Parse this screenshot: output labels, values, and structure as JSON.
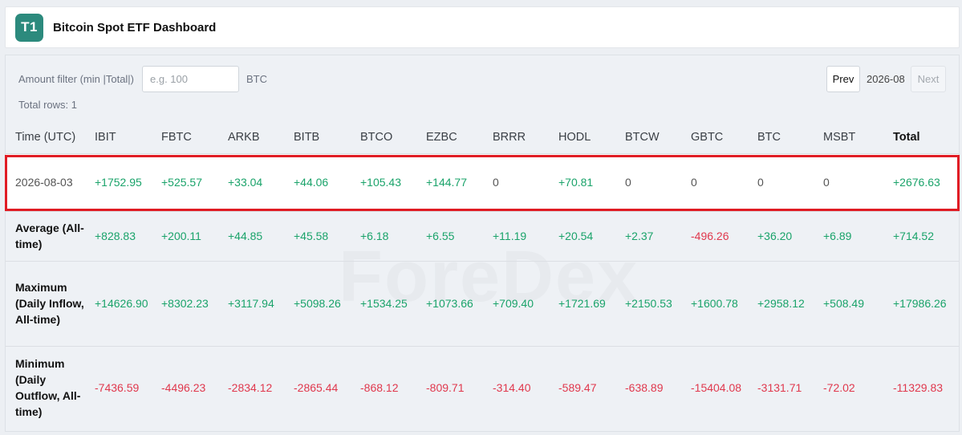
{
  "header": {
    "logo_text": "T1",
    "title": "Bitcoin Spot ETF Dashboard"
  },
  "controls": {
    "filter_label": "Amount filter (min |Total|)",
    "filter_placeholder": "e.g. 100",
    "filter_value": "",
    "unit": "BTC",
    "total_rows": "Total rows: 1",
    "prev_label": "Prev",
    "month": "2026-08",
    "next_label": "Next"
  },
  "watermark": "ForeDex",
  "table": {
    "columns": [
      "Time (UTC)",
      "IBIT",
      "FBTC",
      "ARKB",
      "BITB",
      "BTCO",
      "EZBC",
      "BRRR",
      "HODL",
      "BTCW",
      "GBTC",
      "BTC",
      "MSBT",
      "Total"
    ],
    "rows": [
      {
        "key": "data",
        "label": "2026-08-03",
        "values": [
          "+1752.95",
          "+525.57",
          "+33.04",
          "+44.06",
          "+105.43",
          "+144.77",
          "0",
          "+70.81",
          "0",
          "0",
          "0",
          "0",
          "+2676.63"
        ]
      },
      {
        "key": "avg",
        "label": "Average (All-time)",
        "values": [
          "+828.83",
          "+200.11",
          "+44.85",
          "+45.58",
          "+6.18",
          "+6.55",
          "+11.19",
          "+20.54",
          "+2.37",
          "-496.26",
          "+36.20",
          "+6.89",
          "+714.52"
        ]
      },
      {
        "key": "max",
        "label": "Maximum (Daily Inflow, All-time)",
        "values": [
          "+14626.90",
          "+8302.23",
          "+3117.94",
          "+5098.26",
          "+1534.25",
          "+1073.66",
          "+709.40",
          "+1721.69",
          "+2150.53",
          "+1600.78",
          "+2958.12",
          "+508.49",
          "+17986.26"
        ]
      },
      {
        "key": "min",
        "label": "Minimum (Daily Outflow, All-time)",
        "values": [
          "-7436.59",
          "-4496.23",
          "-2834.12",
          "-2865.44",
          "-868.12",
          "-809.71",
          "-314.40",
          "-589.47",
          "-638.89",
          "-15404.08",
          "-3131.71",
          "-72.02",
          "-11329.83"
        ]
      }
    ]
  },
  "colors": {
    "positive": "#1aa36a",
    "negative": "#e0384d",
    "brand": "#2c8a7d",
    "highlight": "#e01c24"
  }
}
